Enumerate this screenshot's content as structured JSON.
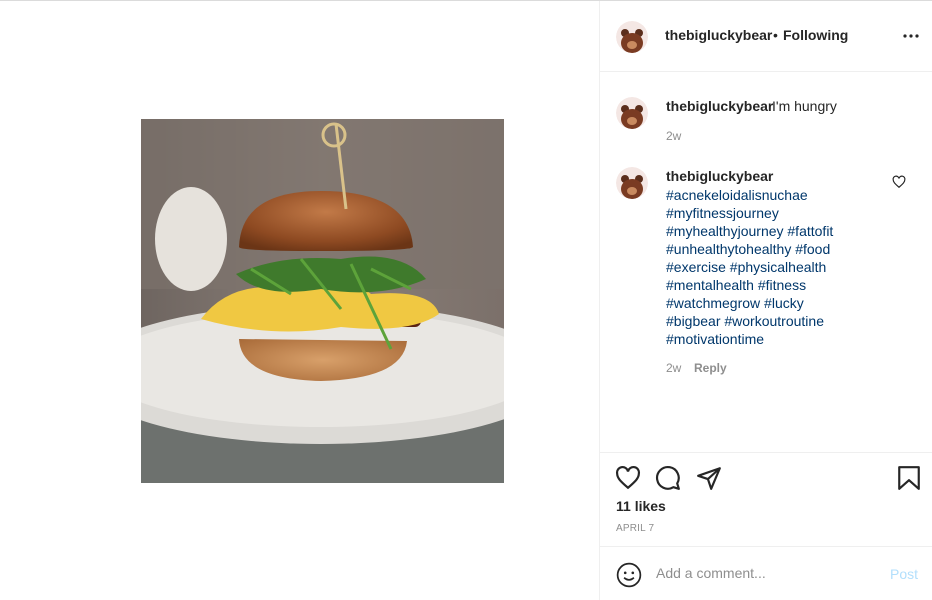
{
  "post": {
    "username": "thebigluckybear",
    "dot": "•",
    "follow_label": "Following",
    "caption_text": "I'm hungry",
    "caption_time": "2w",
    "comment": {
      "username": "thebigluckybear",
      "hashtags": [
        "#acnekeloidalisnuchae",
        "#myfitnessjourney",
        "#myhealthyjourney #fattofit",
        "#unhealthytohealthy #food",
        "#exercise #physicalhealth",
        "#mentalhealth #fitness",
        "#watchmegrow #lucky",
        "#bigbear #workoutroutine",
        "#motivationtime"
      ],
      "time": "2w",
      "reply_label": "Reply"
    },
    "likes": "11 likes",
    "date": "APRIL 7",
    "add_comment_placeholder": "Add a comment...",
    "post_label": "Post"
  },
  "icons": {
    "more": "more-options-icon",
    "like": "heart-icon",
    "comment": "comment-icon",
    "share": "share-icon",
    "save": "bookmark-icon",
    "emoji": "emoji-icon"
  },
  "colors": {
    "hashtag": "#00376b",
    "post_button_disabled": "#b2dffc",
    "muted": "#8e8e8e"
  }
}
